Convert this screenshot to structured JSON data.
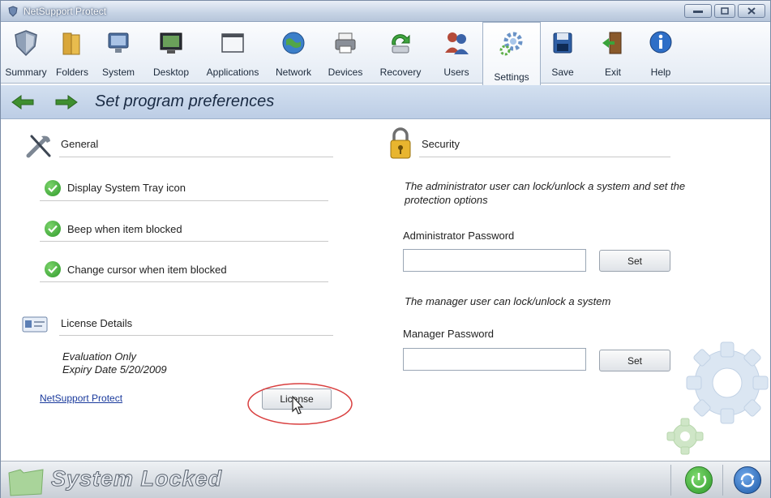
{
  "window": {
    "title": "NetSupport Protect"
  },
  "toolbar": {
    "items": [
      {
        "label": "Summary",
        "icon": "shield-icon"
      },
      {
        "label": "Folders",
        "icon": "folders-icon"
      },
      {
        "label": "System",
        "icon": "system-icon"
      },
      {
        "label": "Desktop",
        "icon": "desktop-icon"
      },
      {
        "label": "Applications",
        "icon": "applications-icon"
      },
      {
        "label": "Network",
        "icon": "globe-icon"
      },
      {
        "label": "Devices",
        "icon": "printer-icon"
      },
      {
        "label": "Recovery",
        "icon": "recovery-icon"
      },
      {
        "label": "Users",
        "icon": "users-icon"
      },
      {
        "label": "Settings",
        "icon": "gear-icon"
      },
      {
        "label": "Save",
        "icon": "floppy-icon"
      },
      {
        "label": "Exit",
        "icon": "door-icon"
      },
      {
        "label": "Help",
        "icon": "info-icon"
      }
    ],
    "active": "Settings"
  },
  "nav": {
    "heading": "Set program preferences"
  },
  "general": {
    "title": "General",
    "options": [
      {
        "label": "Display System Tray icon",
        "checked": true
      },
      {
        "label": "Beep when item blocked",
        "checked": true
      },
      {
        "label": "Change cursor when item blocked",
        "checked": true
      }
    ]
  },
  "license": {
    "title": "License Details",
    "line1": "Evaluation Only",
    "line2": "Expiry Date 5/20/2009",
    "link": "NetSupport Protect",
    "button": "License"
  },
  "security": {
    "title": "Security",
    "admin_desc": "The administrator user can lock/unlock a system and set the protection options",
    "admin_label": "Administrator Password",
    "admin_value": "",
    "admin_button": "Set",
    "manager_desc": "The manager user can lock/unlock a system",
    "manager_label": "Manager Password",
    "manager_value": "",
    "manager_button": "Set"
  },
  "status": {
    "text": "System Locked"
  },
  "colors": {
    "nav_bg": "#c7d6ea",
    "check_green": "#3aa33a",
    "annotation_red": "#d94040"
  }
}
